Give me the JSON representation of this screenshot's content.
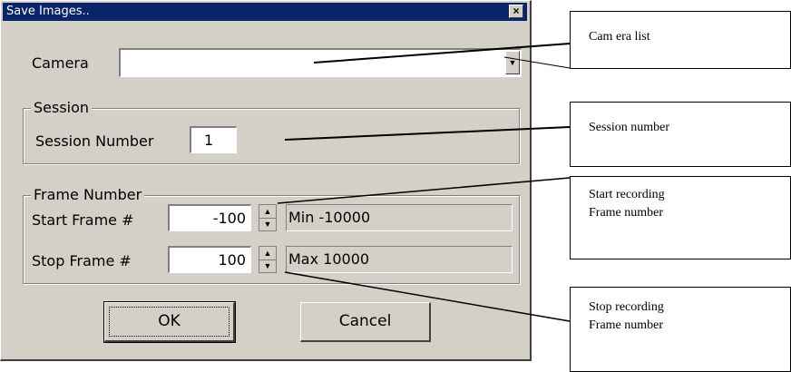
{
  "dialog": {
    "title": "Save Images..",
    "close_glyph": "×",
    "camera_label": "Camera",
    "camera_value": "",
    "session_group": "Session",
    "session_number_label": "Session Number",
    "session_number_value": "1",
    "frame_group": "Frame Number",
    "start_frame_label": "Start Frame #",
    "start_frame_value": "-100",
    "start_frame_min": "Min -10000",
    "stop_frame_label": "Stop Frame #",
    "stop_frame_value": "100",
    "stop_frame_max": "Max 10000",
    "ok_label": "OK",
    "cancel_label": "Cancel"
  },
  "annotations": {
    "camera_list": "Cam era list",
    "session_number": "Session number",
    "start_recording_line1": "Start recording",
    "start_recording_line2": "Frame number",
    "stop_recording_line1": "Stop recording",
    "stop_recording_line2": "Frame number"
  },
  "icons": {
    "close": "close-icon",
    "combo_arrow": "chevron-down-icon",
    "spin_up": "spin-up-icon",
    "spin_down": "spin-down-icon"
  }
}
